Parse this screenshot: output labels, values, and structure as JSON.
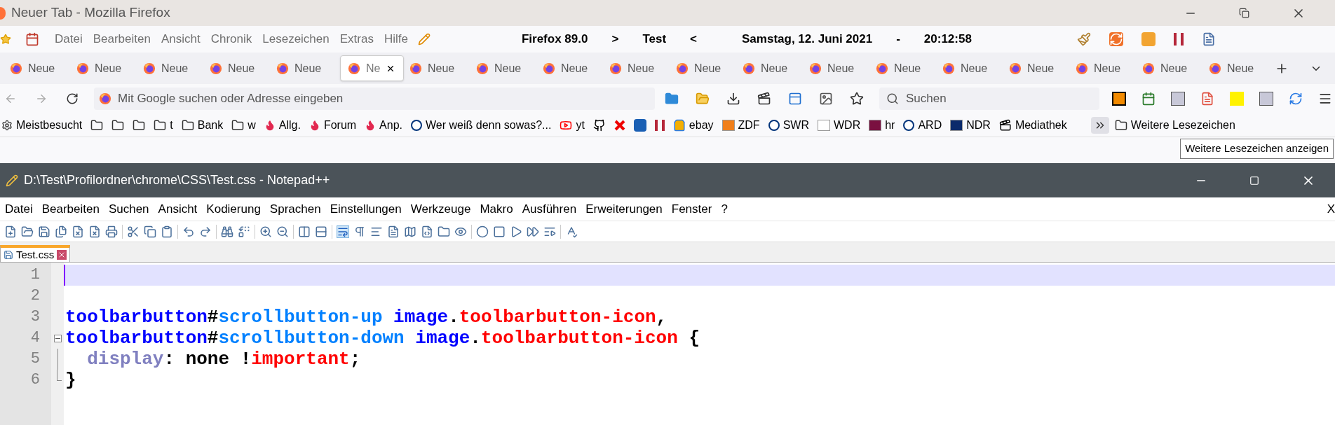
{
  "firefox": {
    "title": "Neuer Tab - Mozilla Firefox",
    "menu": [
      "Datei",
      "Bearbeiten",
      "Ansicht",
      "Chronik",
      "Lesezeichen",
      "Extras",
      "Hilfe"
    ],
    "info": [
      "Firefox 89.0",
      ">",
      "Test",
      "<",
      "Samstag, 12. Juni 2021",
      "-",
      "20:12:58"
    ],
    "tabs": [
      {
        "label": "Neue",
        "selected": false
      },
      {
        "label": "Neue",
        "selected": false
      },
      {
        "label": "Neue",
        "selected": false
      },
      {
        "label": "Neue",
        "selected": false
      },
      {
        "label": "Neue",
        "selected": false
      },
      {
        "label": "Ne",
        "selected": true
      },
      {
        "label": "Neue",
        "selected": false
      },
      {
        "label": "Neue",
        "selected": false
      },
      {
        "label": "Neue",
        "selected": false
      },
      {
        "label": "Neue",
        "selected": false
      },
      {
        "label": "Neue",
        "selected": false
      },
      {
        "label": "Neue",
        "selected": false
      },
      {
        "label": "Neue",
        "selected": false
      },
      {
        "label": "Neue",
        "selected": false
      },
      {
        "label": "Neue",
        "selected": false
      },
      {
        "label": "Neue",
        "selected": false
      },
      {
        "label": "Neue",
        "selected": false
      },
      {
        "label": "Neue",
        "selected": false
      },
      {
        "label": "Neue",
        "selected": false
      }
    ],
    "url_placeholder": "Mit Google suchen oder Adresse eingeben",
    "search_placeholder": "Suchen",
    "bookmarks": [
      {
        "kind": "gear",
        "label": "Meistbesucht"
      },
      {
        "kind": "folder"
      },
      {
        "kind": "folder"
      },
      {
        "kind": "folder"
      },
      {
        "kind": "folder",
        "label": "t"
      },
      {
        "kind": "folder",
        "label": "Bank"
      },
      {
        "kind": "folder",
        "label": "w"
      },
      {
        "kind": "flame",
        "label": "Allg."
      },
      {
        "kind": "flame",
        "label": "Forum"
      },
      {
        "kind": "flame",
        "label": "Anp."
      },
      {
        "kind": "round",
        "label": "Wer weiß denn sowas?..."
      },
      {
        "kind": "video",
        "label": "yt"
      },
      {
        "kind": "github"
      },
      {
        "kind": "cross"
      },
      {
        "kind": "cb"
      },
      {
        "kind": "css"
      },
      {
        "kind": "bag",
        "label": "ebay"
      },
      {
        "kind": "tile",
        "label": "ZDF",
        "color": "#f07f1a"
      },
      {
        "kind": "round",
        "label": "SWR"
      },
      {
        "kind": "tile",
        "label": "WDR",
        "color": "#ffffff"
      },
      {
        "kind": "tile",
        "label": "hr",
        "color": "#7a1040"
      },
      {
        "kind": "round",
        "label": "ARD"
      },
      {
        "kind": "tile",
        "label": "NDR",
        "color": "#0b2a6b"
      },
      {
        "kind": "clapper",
        "label": "Mediathek"
      }
    ],
    "more_bookmarks": "Weitere Lesezeichen",
    "tooltip": "Weitere Lesezeichen anzeigen"
  },
  "npp": {
    "title": "D:\\Test\\Profilordner\\chrome\\CSS\\Test.css - Notepad++",
    "menu": [
      "Datei",
      "Bearbeiten",
      "Suchen",
      "Ansicht",
      "Kodierung",
      "Sprachen",
      "Einstellungen",
      "Werkzeuge",
      "Makro",
      "Ausführen",
      "Erweiterungen",
      "Fenster",
      "?"
    ],
    "close_doc": "X",
    "tabs": [
      {
        "label": "Test.css",
        "selected": true
      }
    ],
    "lines": [
      {
        "number": "1",
        "kind": "plain",
        "current": true
      },
      {
        "number": "2",
        "kind": "plain",
        "current": false
      },
      {
        "number": "3",
        "kind": "plain",
        "current": false,
        "tokens": [
          {
            "kind": "tag",
            "text": "toolbarbutton"
          },
          {
            "kind": "punct",
            "text": "#"
          },
          {
            "kind": "id",
            "text": "scrollbutton-up"
          },
          {
            "kind": "tag",
            "text": " image"
          },
          {
            "kind": "punct",
            "text": "."
          },
          {
            "kind": "class",
            "text": "toolbarbutton-icon"
          },
          {
            "kind": "punct",
            "text": ","
          }
        ]
      },
      {
        "number": "4",
        "kind": "fold_start",
        "current": false,
        "tokens": [
          {
            "kind": "tag",
            "text": "toolbarbutton"
          },
          {
            "kind": "punct",
            "text": "#"
          },
          {
            "kind": "id",
            "text": "scrollbutton-down"
          },
          {
            "kind": "tag",
            "text": " image"
          },
          {
            "kind": "punct",
            "text": "."
          },
          {
            "kind": "class",
            "text": "toolbarbutton-icon"
          },
          {
            "kind": "punct",
            "text": " {"
          }
        ]
      },
      {
        "number": "5",
        "kind": "fold_body",
        "current": false,
        "tokens": [
          {
            "kind": "property",
            "text": "  display"
          },
          {
            "kind": "punct",
            "text": ": none !"
          },
          {
            "kind": "important",
            "text": "important"
          },
          {
            "kind": "punct",
            "text": ";"
          }
        ]
      },
      {
        "number": "6",
        "kind": "fold_end",
        "current": false,
        "tokens": [
          {
            "kind": "punct",
            "text": "}"
          }
        ]
      }
    ]
  }
}
